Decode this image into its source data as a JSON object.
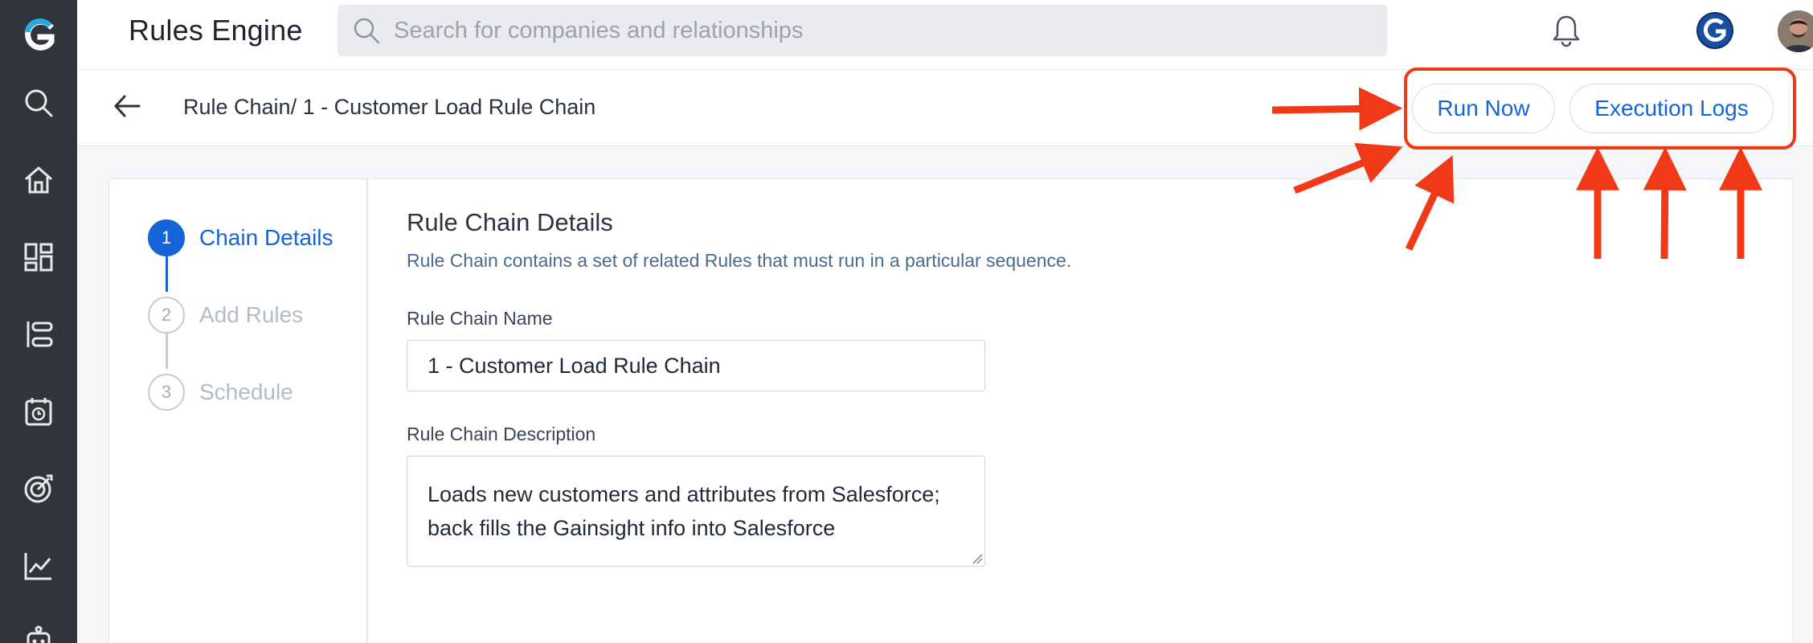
{
  "app": {
    "title": "Rules Engine"
  },
  "search": {
    "placeholder": "Search for companies and relationships"
  },
  "header": {
    "breadcrumb": "Rule Chain/ 1 - Customer Load Rule Chain",
    "run_now_label": "Run Now",
    "execution_logs_label": "Execution Logs"
  },
  "rail": {
    "icons": [
      "logo-g-icon",
      "search-icon",
      "home-icon",
      "dashboard-icon",
      "timeline-icon",
      "calendar-icon",
      "target-icon",
      "chart-icon",
      "robot-icon"
    ]
  },
  "stepper": {
    "steps": [
      {
        "num": "1",
        "label": "Chain Details",
        "active": true
      },
      {
        "num": "2",
        "label": "Add Rules",
        "active": false
      },
      {
        "num": "3",
        "label": "Schedule",
        "active": false
      }
    ]
  },
  "form": {
    "title": "Rule Chain Details",
    "subtitle": "Rule Chain contains a set of related Rules that must run in a particular sequence.",
    "name_label": "Rule Chain Name",
    "name_value": "1 - Customer Load Rule Chain",
    "description_label": "Rule Chain Description",
    "description_value": "Loads new customers and attributes from Salesforce; back fills the Gainsight info into Salesforce"
  },
  "colors": {
    "accent": "#1565d8",
    "rail": "#30343b",
    "annotation": "#f03a17"
  }
}
